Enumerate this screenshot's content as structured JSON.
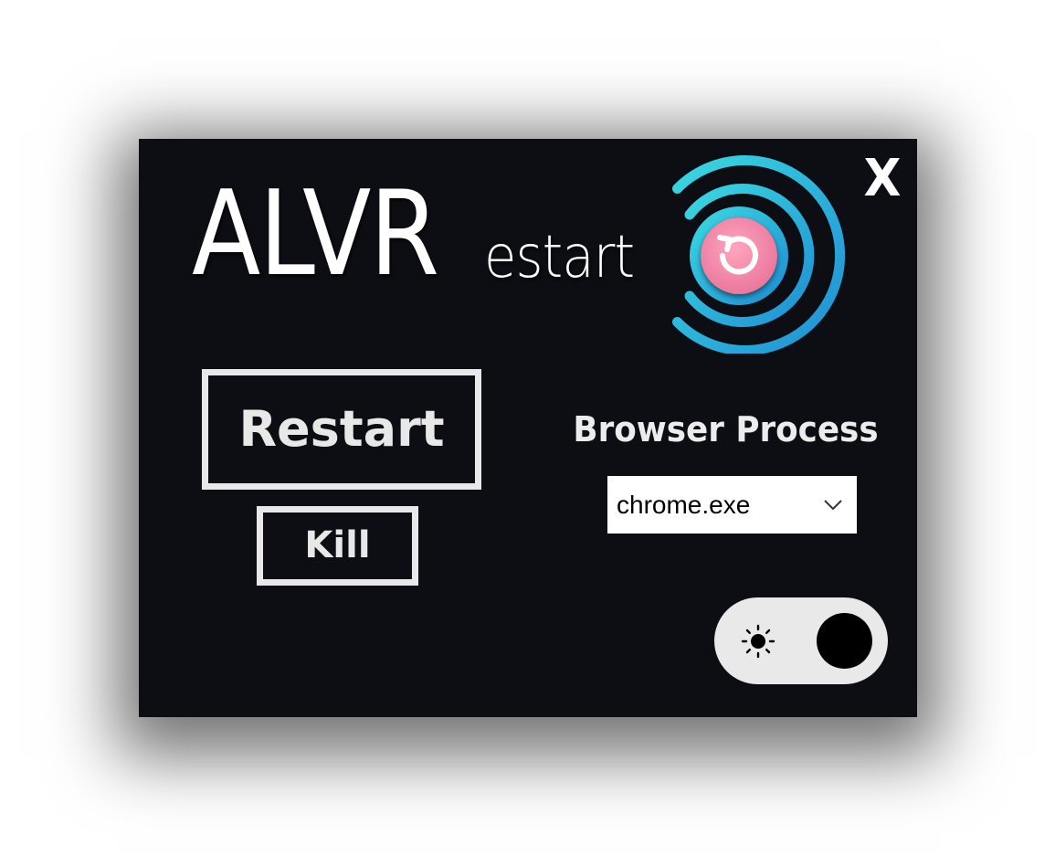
{
  "window": {
    "title_large": "ALVR",
    "title_small": "estart",
    "close_label": "X"
  },
  "icons": {
    "logo": "restart-signal-logo-icon",
    "close": "close-icon",
    "dropdown": "chevron-down-icon",
    "theme": "sun-icon"
  },
  "colors": {
    "background": "#0d0e14",
    "button_border": "#e8e8e8",
    "logo_arc": "#2ec6d9",
    "logo_center": "#f28aa8",
    "toggle_bg": "#e9e9e9"
  },
  "actions": {
    "restart_label": "Restart",
    "kill_label": "Kill"
  },
  "browser": {
    "label": "Browser Process",
    "selected": "chrome.exe"
  }
}
